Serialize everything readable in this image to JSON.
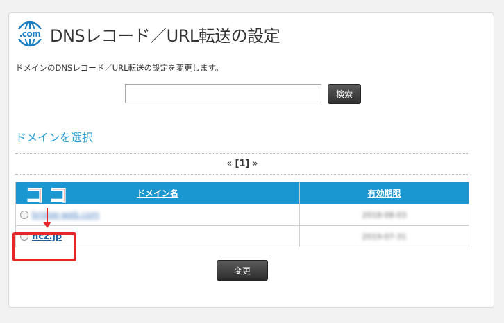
{
  "header": {
    "icon_text": ".com",
    "title": "DNSレコード／URL転送の設定"
  },
  "description": "ドメインのDNSレコード／URL転送の設定を変更します。",
  "search": {
    "value": "",
    "placeholder": "",
    "button_label": "検索"
  },
  "section_title": "ドメインを選択",
  "pagination": {
    "prev": "«",
    "current": "[1]",
    "next": "»"
  },
  "table": {
    "headers": [
      "ドメイン名",
      "有効期限"
    ],
    "rows": [
      {
        "domain": "bridge-web.com",
        "expiry": "2018-08-03"
      },
      {
        "domain": "hcz.jp",
        "expiry": "2019-07-31"
      }
    ]
  },
  "change_button_label": "変更",
  "annotation": {
    "label": "ココ",
    "color": "#e8262a"
  },
  "colors": {
    "accent": "#2a9fd6",
    "table_header": "#1a96d0",
    "button_dark": "#3a3a3a"
  }
}
